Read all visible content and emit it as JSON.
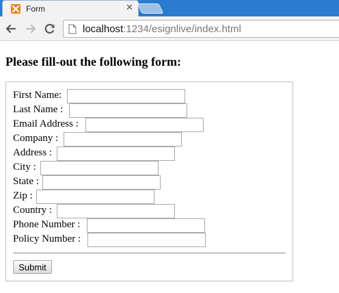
{
  "browser": {
    "tab": {
      "title": "Form"
    },
    "address_bar": {
      "host": "localhost",
      "rest": ":1234/esignlive/index.html"
    }
  },
  "page": {
    "heading": "Please fill-out the following form:",
    "form": {
      "fields": [
        {
          "label": "First Name:",
          "value": ""
        },
        {
          "label": "Last Name :",
          "value": ""
        },
        {
          "label": "Email Address :",
          "value": ""
        },
        {
          "label": "Company :",
          "value": ""
        },
        {
          "label": "Address :",
          "value": ""
        },
        {
          "label": "City :",
          "value": ""
        },
        {
          "label": "State :",
          "value": ""
        },
        {
          "label": "Zip :",
          "value": ""
        },
        {
          "label": "Country :",
          "value": ""
        },
        {
          "label": "Phone Number :",
          "value": ""
        },
        {
          "label": "Policy Number :",
          "value": ""
        }
      ],
      "submit_label": "Submit"
    }
  },
  "colors": {
    "tabstrip": "#2b7bd1",
    "favicon": "#e8851e"
  },
  "icons": {
    "favicon": "xampp-icon",
    "back": "back-arrow-icon",
    "forward": "forward-arrow-icon",
    "reload": "reload-icon",
    "page": "page-icon",
    "close": "close-icon"
  }
}
